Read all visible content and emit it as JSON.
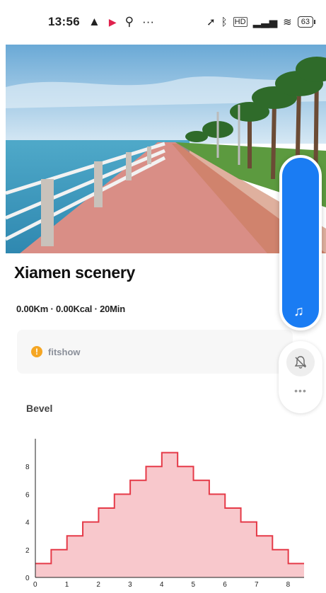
{
  "status_bar": {
    "time": "13:56",
    "battery": "63",
    "left_icons": [
      "warning-triangle-icon",
      "flag-icon",
      "pin-icon",
      "more-dots-icon"
    ],
    "right_icons": [
      "location-arrow-icon",
      "bluetooth-icon",
      "hd-signal-icon",
      "wifi-icon",
      "battery-icon"
    ],
    "more_text": "···",
    "sig_text": "HD"
  },
  "route": {
    "title": "Xiamen scenery",
    "stats": "0.00Km · 0.00Kcal · 20Min"
  },
  "brand": {
    "icon_text": "!",
    "name": "fitshow"
  },
  "section": {
    "label": "Bevel"
  },
  "controls": {
    "music_icon": "music-note-icon",
    "music_glyph": "♫",
    "bell_icon": "bell-off-icon",
    "more_glyph": "•••"
  },
  "colors": {
    "accent": "#1a7cf3",
    "chart_fill": "#f8c8cc",
    "chart_line": "#e53a48",
    "warning": "#f5a623"
  },
  "chart_data": {
    "type": "area",
    "step": true,
    "x": [
      0,
      0.5,
      1,
      1.5,
      2,
      2.5,
      3,
      3.5,
      4,
      4.5,
      5,
      5.5,
      6,
      6.5,
      7,
      7.5,
      8,
      8.5
    ],
    "values": [
      1,
      2,
      3,
      4,
      5,
      6,
      7,
      8,
      9,
      8,
      7,
      6,
      5,
      4,
      3,
      2,
      1,
      0
    ],
    "x_ticks": [
      0,
      1,
      2,
      3,
      4,
      5,
      6,
      7,
      8
    ],
    "y_ticks": [
      0,
      2,
      4,
      6,
      8
    ],
    "xlim": [
      0,
      8.5
    ],
    "ylim": [
      0,
      10
    ],
    "grid": false
  }
}
